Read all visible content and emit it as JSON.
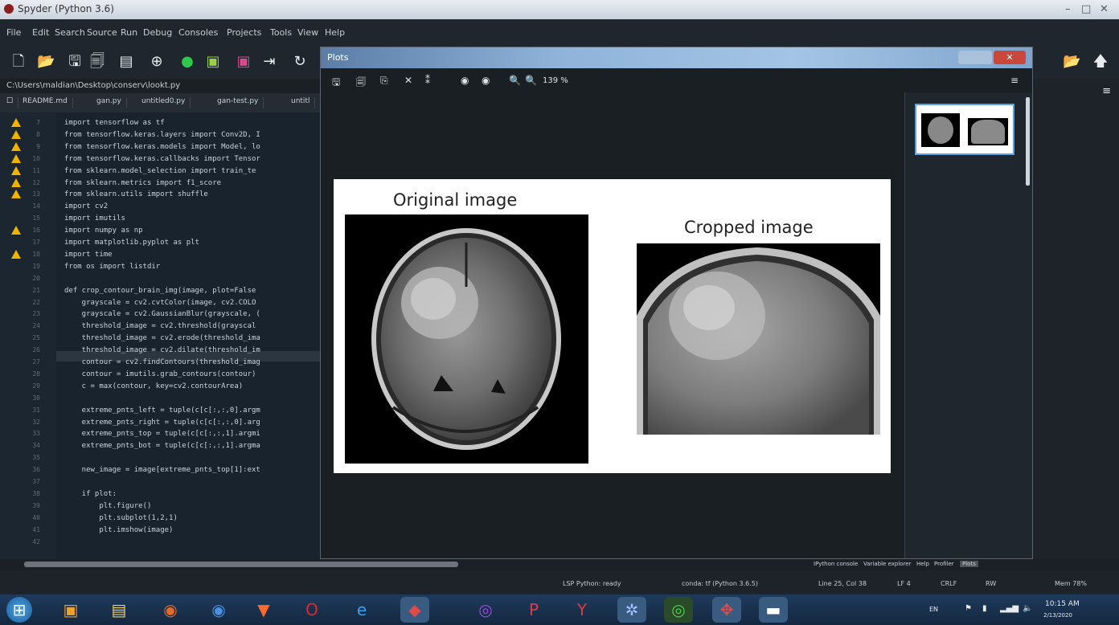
{
  "window": {
    "title": "Spyder (Python 3.6)"
  },
  "menu": [
    "File",
    "Edit",
    "Search",
    "Source",
    "Run",
    "Debug",
    "Consoles",
    "Projects",
    "Tools",
    "View",
    "Help"
  ],
  "path": "C:\\Users\\maldian\\Desktop\\conserv\\lookt.py",
  "tabs": [
    "README.md",
    "gan.py",
    "untitled0.py",
    "gan-test.py",
    "untitl"
  ],
  "editor": {
    "line_numbers": [
      "7",
      "8",
      "9",
      "10",
      "11",
      "12",
      "13",
      "14",
      "15",
      "16",
      "17",
      "18",
      "19",
      "20",
      "21",
      "22",
      "23",
      "24",
      "25",
      "26",
      "27",
      "28",
      "29",
      "30",
      "31",
      "32",
      "33",
      "34",
      "35",
      "36",
      "37",
      "38",
      "39",
      "40",
      "41",
      "42"
    ],
    "lines": [
      "import tensorflow as tf",
      "from tensorflow.keras.layers import Conv2D, I",
      "from tensorflow.keras.models import Model, lo",
      "from tensorflow.keras.callbacks import Tensor",
      "from sklearn.model_selection import train_te",
      "from sklearn.metrics import f1_score",
      "from sklearn.utils import shuffle",
      "import cv2",
      "import imutils",
      "import numpy as np",
      "import matplotlib.pyplot as plt",
      "import time",
      "from os import listdir",
      "",
      "def crop_contour_brain_img(image, plot=False",
      "    grayscale = cv2.cvtColor(image, cv2.COLO",
      "    grayscale = cv2.GaussianBlur(grayscale, (",
      "    threshold_image = cv2.threshold(grayscal",
      "    threshold_image = cv2.erode(threshold_ima",
      "    threshold_image = cv2.dilate(threshold_im",
      "    contour = cv2.findContours(threshold_imag",
      "    contour = imutils.grab_contours(contour)",
      "    c = max(contour, key=cv2.contourArea)",
      "",
      "    extreme_pnts_left = tuple(c[c[:,:,0].argm",
      "    extreme_pnts_right = tuple(c[c[:,:,0].arg",
      "    extreme_pnts_top = tuple(c[c[:,:,1].argmi",
      "    extreme_pnts_bot = tuple(c[c[:,:,1].argma",
      "",
      "    new_image = image[extreme_pnts_top[1]:ext",
      "",
      "    if plot:",
      "        plt.figure()",
      "        plt.subplot(1,2,1)",
      "        plt.imshow(image)",
      ""
    ]
  },
  "plots": {
    "title": "Plots",
    "zoom": "139 %",
    "figure": {
      "left_title": "Original image",
      "right_title": "Cropped image"
    }
  },
  "panes": [
    "IPython console",
    "Variable explorer",
    "Help",
    "Profiler",
    "Plots"
  ],
  "status": {
    "lsp": "LSP Python: ready",
    "conda": "conda: tf (Python 3.6.5)",
    "position": "Line 25, Col 38",
    "eol": "LF 4",
    "encoding": "CRLF",
    "perm": "RW",
    "mem": "Mem 78%"
  },
  "taskbar": {
    "time": "10:15 AM",
    "date": "2/13/2020",
    "lang": "EN"
  }
}
